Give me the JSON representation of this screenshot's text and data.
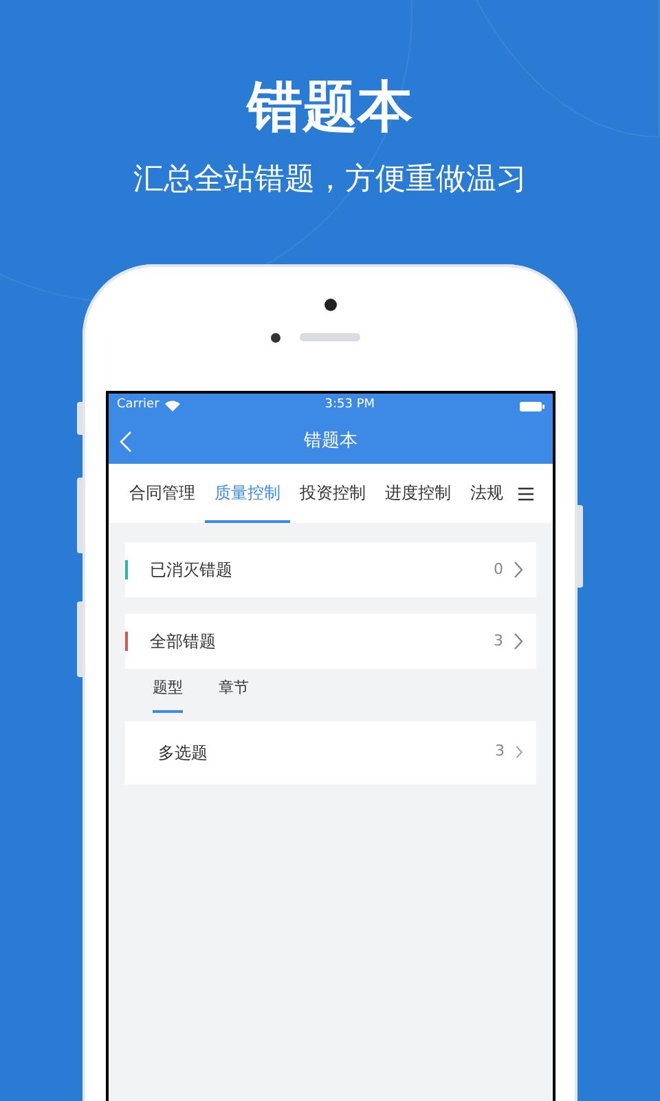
{
  "headline": "错题本",
  "subtitle": "汇总全站错题，方便重做温习",
  "status_bar": {
    "carrier": "Carrier",
    "time": "3:53 PM"
  },
  "nav_bar": {
    "title": "错题本"
  },
  "tabs": [
    {
      "label": "合同管理",
      "selected": false
    },
    {
      "label": "质量控制",
      "selected": true
    },
    {
      "label": "投资控制",
      "selected": false
    },
    {
      "label": "进度控制",
      "selected": false
    },
    {
      "label": "法规",
      "selected": false
    }
  ],
  "summary_rows": [
    {
      "label": "已消灭错题",
      "count": "0",
      "color": "#2bb89a"
    },
    {
      "label": "全部错题",
      "count": "3",
      "color": "#d9534f"
    }
  ],
  "sub_tabs": [
    {
      "label": "题型",
      "selected": true
    },
    {
      "label": "章节",
      "selected": false
    }
  ],
  "question_types": [
    {
      "label": "多选题",
      "count": "3"
    }
  ]
}
